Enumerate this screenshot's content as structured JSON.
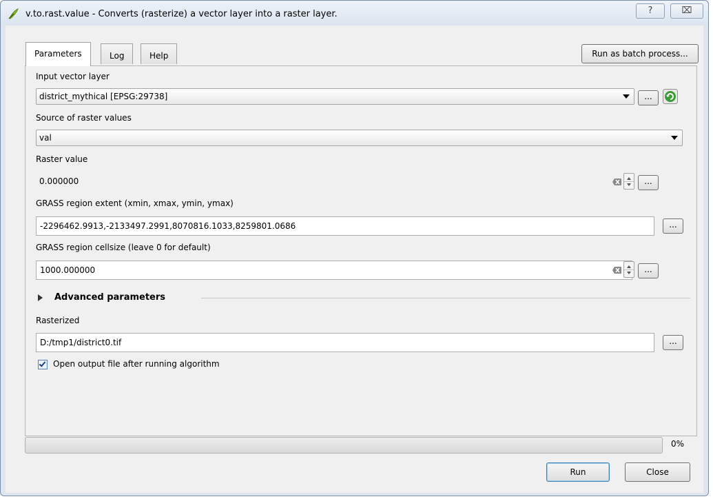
{
  "window": {
    "title": "v.to.rast.value - Converts (rasterize) a vector layer into a raster layer.",
    "help_glyph": "?",
    "close_glyph": "⌧"
  },
  "tabs": [
    {
      "label": "Parameters",
      "active": true
    },
    {
      "label": "Log",
      "active": false
    },
    {
      "label": "Help",
      "active": false
    }
  ],
  "batch_button": "Run as batch process...",
  "params": {
    "input_vector": {
      "label": "Input vector layer",
      "value": "district_mythical [EPSG:29738]"
    },
    "source_values": {
      "label": "Source of raster values",
      "value": "val"
    },
    "raster_value": {
      "label": "Raster value",
      "value": "0.000000"
    },
    "region_extent": {
      "label": "GRASS region extent (xmin, xmax, ymin, ymax)",
      "value": "-2296462.9913,-2133497.2991,8070816.1033,8259801.0686"
    },
    "cellsize": {
      "label": "GRASS region cellsize (leave 0 for default)",
      "value": "1000.000000"
    },
    "advanced": {
      "label": "Advanced parameters"
    },
    "rasterized": {
      "label": "Rasterized",
      "value": "D:/tmp1/district0.tif"
    },
    "open_output": {
      "label": "Open output file after running algorithm",
      "checked": true
    }
  },
  "dots": "...",
  "progress": {
    "value": 0,
    "text": "0%"
  },
  "buttons": {
    "run": "Run",
    "close": "Close"
  },
  "colors": {
    "accent": "#3c7fb1",
    "refresh": "#3d9b37",
    "qgis_green": "#8cbf2a"
  }
}
